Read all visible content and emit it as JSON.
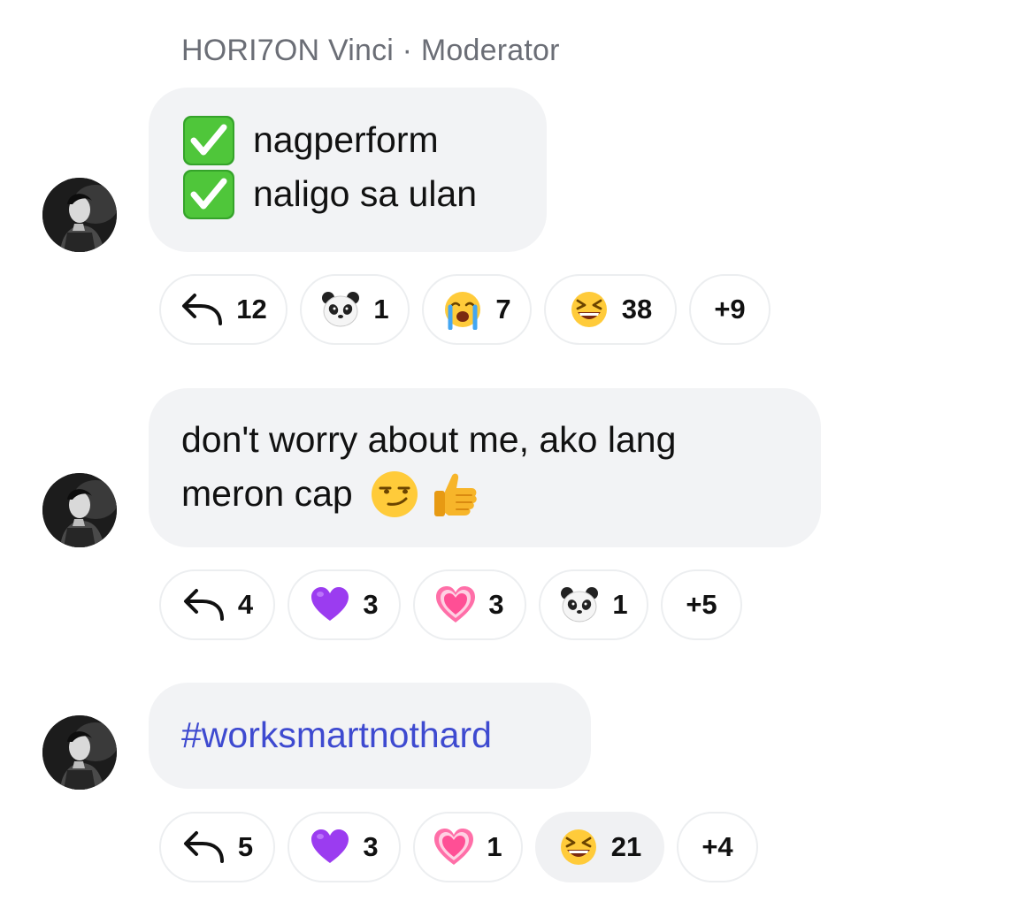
{
  "messages": [
    {
      "sender": "HORI7ON Vinci · Moderator",
      "lines": [
        "nagperform",
        "naligo sa ulan"
      ],
      "line_icon": "check-mark-button-emoji",
      "reactions": [
        {
          "icon": "reply-arrow-icon",
          "count": "12"
        },
        {
          "icon": "panda-emoji",
          "count": "1"
        },
        {
          "icon": "loudly-crying-face-emoji",
          "count": "7"
        },
        {
          "icon": "grinning-squinting-face-emoji",
          "count": "38"
        },
        {
          "more": "+9"
        }
      ]
    },
    {
      "lines": [
        "don't worry about me, ako lang",
        "meron cap"
      ],
      "trailing_emojis": [
        "smirking-face-emoji",
        "thumbs-up-emoji"
      ],
      "reactions": [
        {
          "icon": "reply-arrow-icon",
          "count": "4"
        },
        {
          "icon": "purple-heart-emoji",
          "count": "3"
        },
        {
          "icon": "growing-heart-emoji",
          "count": "3"
        },
        {
          "icon": "panda-emoji",
          "count": "1"
        },
        {
          "more": "+5"
        }
      ]
    },
    {
      "lines": [
        "#worksmartnothard"
      ],
      "line_color": "#3e4ad0",
      "reactions": [
        {
          "icon": "reply-arrow-icon",
          "count": "5"
        },
        {
          "icon": "purple-heart-emoji",
          "count": "3"
        },
        {
          "icon": "growing-heart-emoji",
          "count": "1"
        },
        {
          "icon": "grinning-squinting-face-emoji",
          "count": "21",
          "active": true
        },
        {
          "more": "+4"
        }
      ]
    }
  ],
  "colors": {
    "bubble": "#f2f3f5",
    "sender": "#6b6e76",
    "hashtag": "#3e4ad0",
    "active_reaction": "#f0f1f3"
  }
}
